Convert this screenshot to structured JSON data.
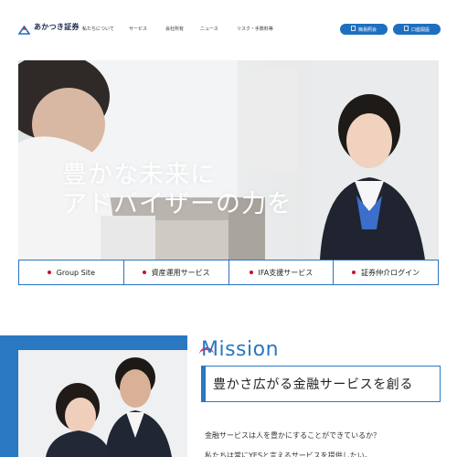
{
  "brand": {
    "name": "あかつき証券",
    "accent": "#1f6fc0",
    "mark_red": "#d7263d"
  },
  "nav": {
    "items": [
      "私たちについて",
      "サービス",
      "会社所有",
      "ニュース",
      "リスク・手数料等"
    ]
  },
  "header_buttons": {
    "primary": "簡易照会",
    "secondary": "口座開設"
  },
  "hero": {
    "line1": "豊かな未来に",
    "line2": "アドバイザーの力を"
  },
  "links": [
    {
      "label": "Group Site"
    },
    {
      "label": "資産運用サービス"
    },
    {
      "label": "IFA支援サービス"
    },
    {
      "label": "証券仲介ログイン"
    }
  ],
  "mission": {
    "title": "Mission",
    "tagline": "豊かさ広がる金融サービスを創る",
    "body1": "金融サービスは人を豊かにすることができているか？",
    "body2": "私たちは常にYESと言えるサービスを提供したい。"
  }
}
